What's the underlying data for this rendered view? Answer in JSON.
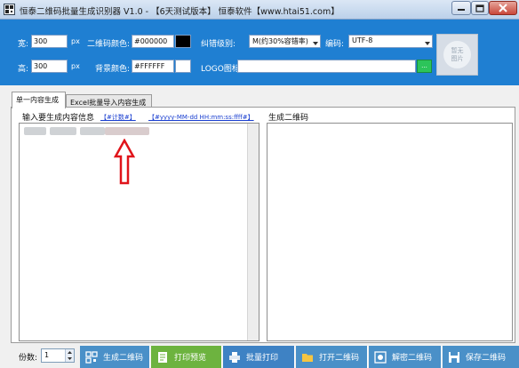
{
  "window": {
    "title": "恒泰二维码批量生成识别器 V1.0 - 【6天测试版本】 恒泰软件【www.htai51.com】",
    "icons": [
      "app-icon",
      "minimize-icon",
      "maximize-icon",
      "close-icon"
    ]
  },
  "settings": {
    "width_label": "宽:",
    "width_value": "300",
    "width_unit": "px",
    "height_label": "高:",
    "height_value": "300",
    "height_unit": "px",
    "qr_color_label": "二维码颜色:",
    "qr_color_value": "#000000",
    "qr_color_swatch": "#000000",
    "bg_color_label": "背景颜色:",
    "bg_color_value": "#FFFFFF",
    "bg_color_swatch": "#ffffff",
    "error_level_label": "纠错级别:",
    "error_level_value": "M(约30%容错率)",
    "encoding_label": "编码:",
    "encoding_value": "UTF-8",
    "logo_label": "LOGO图标:",
    "logo_value": "",
    "logo_browse_label": "...",
    "preview_placeholder": "暂无图片",
    "panel_color": "#1f7fd2"
  },
  "tabs": [
    {
      "label": "单一内容生成",
      "active": true
    },
    {
      "label": "Excel批量导入内容生成",
      "active": false
    }
  ],
  "single": {
    "input_group_label": "输入要生成内容信息",
    "counter_token": "【#计数#】",
    "datetime_token": "【#yyyy-MM-dd HH:mm:ss:ffff#】",
    "output_group_label": "生成二维码"
  },
  "bottom": {
    "count_label": "份数:",
    "count_value": "1",
    "buttons": [
      {
        "label": "生成二维码",
        "icon": "qrcode-icon",
        "color": "#4a90c8"
      },
      {
        "label": "打印预览",
        "icon": "print-preview-icon",
        "color": "#6db33f"
      },
      {
        "label": "批量打印",
        "icon": "printer-icon",
        "color": "#3e82c4"
      },
      {
        "label": "打开二维码",
        "icon": "folder-icon",
        "color": "#4a90c8"
      },
      {
        "label": "解密二维码",
        "icon": "decode-icon",
        "color": "#4a90c8"
      },
      {
        "label": "保存二维码",
        "icon": "save-icon",
        "color": "#4a90c8"
      }
    ]
  }
}
